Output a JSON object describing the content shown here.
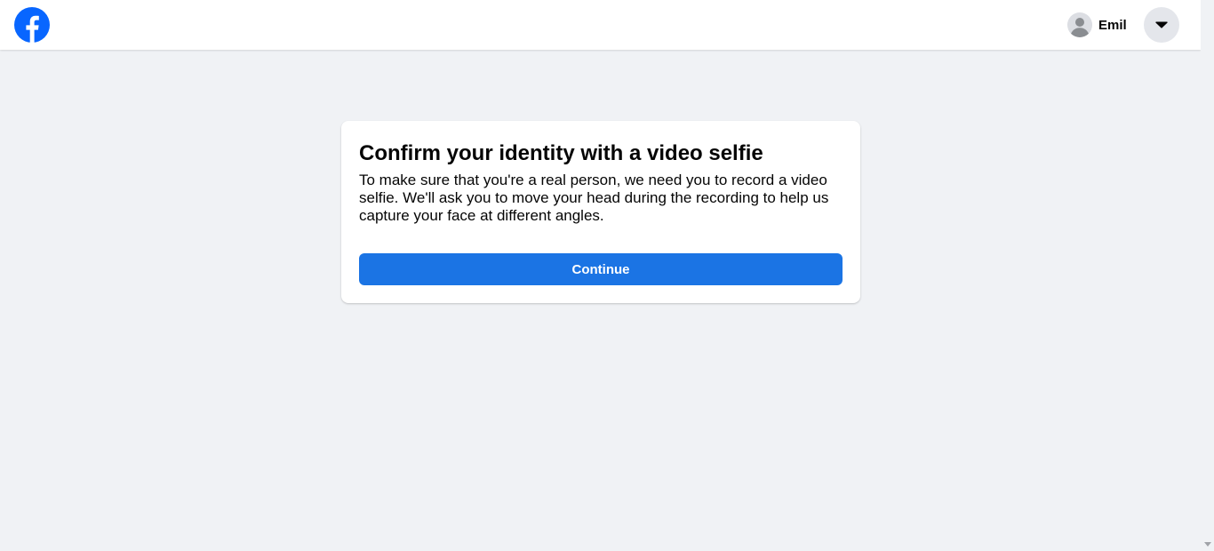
{
  "header": {
    "logo_icon": "facebook-logo-icon",
    "profile_name": "Emil",
    "avatar_icon": "default-avatar-icon",
    "menu_icon": "caret-down-icon",
    "brand_color": "#0866ff"
  },
  "dialog": {
    "title": "Confirm your identity with a video selfie",
    "body": "To make sure that you're a real person, we need you to record a video selfie. We'll ask you to move your head during the recording to help us capture your face at different angles.",
    "continue_label": "Continue",
    "button_color": "#1b74e4"
  }
}
